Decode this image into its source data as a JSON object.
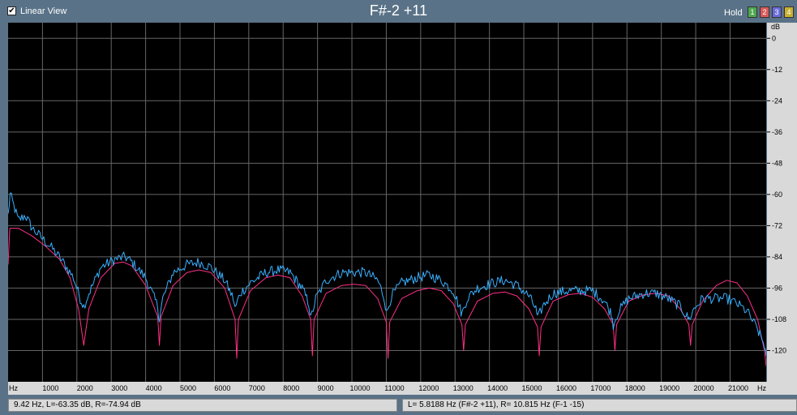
{
  "header": {
    "linear_view_label": "Linear View",
    "linear_view_checked": true,
    "note_title": "F#-2 +11",
    "hold_label": "Hold",
    "hold_buttons": [
      {
        "label": "1",
        "color": "#4fa84f"
      },
      {
        "label": "2",
        "color": "#d85a5a"
      },
      {
        "label": "3",
        "color": "#6a6ad8"
      },
      {
        "label": "4",
        "color": "#c8b030"
      }
    ]
  },
  "status": {
    "left": "9.42 Hz, L=-63.35 dB, R=-74.94 dB",
    "right": "L= 5.8188 Hz (F#-2 +11), R= 10.815 Hz (F-1 -15)"
  },
  "colors": {
    "background": "#5a7287",
    "plot_bg": "#000000",
    "grid": "#666666",
    "left_channel": "#3ab0ff",
    "right_channel": "#ff2f86"
  },
  "chart_data": {
    "type": "line",
    "xlabel": "Hz",
    "ylabel": "dB",
    "x_axis_unit": "Hz",
    "y_axis_unit": "dB",
    "xlim": [
      0,
      22050
    ],
    "ylim": [
      -132,
      6
    ],
    "x_ticks": [
      "1000",
      "2000",
      "3000",
      "4000",
      "5000",
      "6000",
      "7000",
      "8000",
      "9000",
      "10000",
      "11000",
      "12000",
      "13000",
      "14000",
      "15000",
      "16000",
      "17000",
      "18000",
      "19000",
      "20000",
      "21000"
    ],
    "y_ticks": [
      "0",
      "-12",
      "-24",
      "-36",
      "-48",
      "-60",
      "-72",
      "-84",
      "-96",
      "-108",
      "-120"
    ],
    "grid": true,
    "series": [
      {
        "color": "#ff2f86",
        "x": [
          0,
          50,
          300,
          700,
          1100,
          1500,
          1800,
          2050,
          2200,
          2350,
          2700,
          3100,
          3350,
          3600,
          4000,
          4350,
          4400,
          4450,
          4800,
          5200,
          5550,
          5900,
          6300,
          6600,
          6650,
          6700,
          7050,
          7500,
          7850,
          8200,
          8550,
          8800,
          8850,
          8900,
          9250,
          9700,
          10050,
          10400,
          10750,
          11000,
          11050,
          11100,
          11450,
          11900,
          12250,
          12600,
          12950,
          13200,
          13250,
          13300,
          13650,
          14100,
          14450,
          14800,
          15150,
          15400,
          15450,
          15500,
          15850,
          16300,
          16650,
          17000,
          17350,
          17600,
          17650,
          17700,
          18050,
          18500,
          18850,
          19200,
          19550,
          19800,
          19850,
          19900,
          20200,
          20600,
          20900,
          21200,
          21500,
          21800,
          22000,
          22050
        ],
        "values": [
          -87,
          -73,
          -73,
          -76,
          -80,
          -85,
          -92,
          -104,
          -118,
          -104,
          -92,
          -86.5,
          -86,
          -87.5,
          -95,
          -107,
          -118,
          -107,
          -95,
          -90,
          -89,
          -90,
          -96,
          -108,
          -123,
          -108,
          -97,
          -92,
          -91,
          -92,
          -99,
          -108,
          -122,
          -108,
          -98,
          -95,
          -94.5,
          -95,
          -100,
          -109,
          -123,
          -109,
          -100,
          -97,
          -96,
          -97,
          -102,
          -110,
          -120,
          -110,
          -101,
          -98,
          -97.5,
          -99,
          -104,
          -111,
          -122,
          -111,
          -101,
          -98.5,
          -98,
          -99.5,
          -104,
          -110,
          -120,
          -110,
          -101,
          -98.5,
          -98,
          -99,
          -104,
          -110,
          -118,
          -110,
          -101,
          -95,
          -93,
          -94,
          -99,
          -108,
          -120,
          -126
        ]
      },
      {
        "color": "#3ab0ff",
        "x": [
          0,
          60,
          300,
          500,
          700,
          1000,
          1300,
          1600,
          1900,
          2100,
          2200,
          2350,
          2700,
          3100,
          3400,
          3600,
          4000,
          4350,
          4400,
          4500,
          4800,
          5200,
          5550,
          5900,
          6300,
          6550,
          6600,
          6750,
          7050,
          7500,
          7850,
          8200,
          8550,
          8750,
          8800,
          8950,
          9250,
          9700,
          10050,
          10400,
          10750,
          10950,
          11000,
          11150,
          11450,
          11900,
          12250,
          12600,
          12950,
          13150,
          13200,
          13350,
          13650,
          14100,
          14450,
          14800,
          15150,
          15350,
          15400,
          15550,
          15850,
          16300,
          16650,
          17000,
          17350,
          17550,
          17600,
          17750,
          18050,
          18500,
          18850,
          19200,
          19550,
          19750,
          19800,
          19950,
          20200,
          20600,
          20900,
          21200,
          21500,
          21800,
          22000,
          22050
        ],
        "values": [
          -68,
          -60,
          -70,
          -68,
          -73,
          -77,
          -81,
          -86,
          -92,
          -100,
          -103,
          -98,
          -88,
          -85,
          -84,
          -86,
          -92,
          -103,
          -108,
          -100,
          -90,
          -87,
          -86,
          -88,
          -93,
          -100,
          -104,
          -98,
          -94,
          -90,
          -89,
          -90,
          -96,
          -102,
          -108,
          -100,
          -93,
          -90,
          -90,
          -90,
          -93,
          -100,
          -106,
          -99,
          -94,
          -92,
          -91,
          -93,
          -97,
          -104,
          -106,
          -100,
          -96,
          -94,
          -93,
          -95,
          -99,
          -104,
          -108,
          -103,
          -98,
          -97,
          -97,
          -97,
          -101,
          -106,
          -110,
          -105,
          -100,
          -98,
          -98,
          -100,
          -103,
          -107,
          -108,
          -104,
          -100,
          -100,
          -100,
          -102,
          -105,
          -112,
          -118,
          -122
        ]
      }
    ]
  }
}
